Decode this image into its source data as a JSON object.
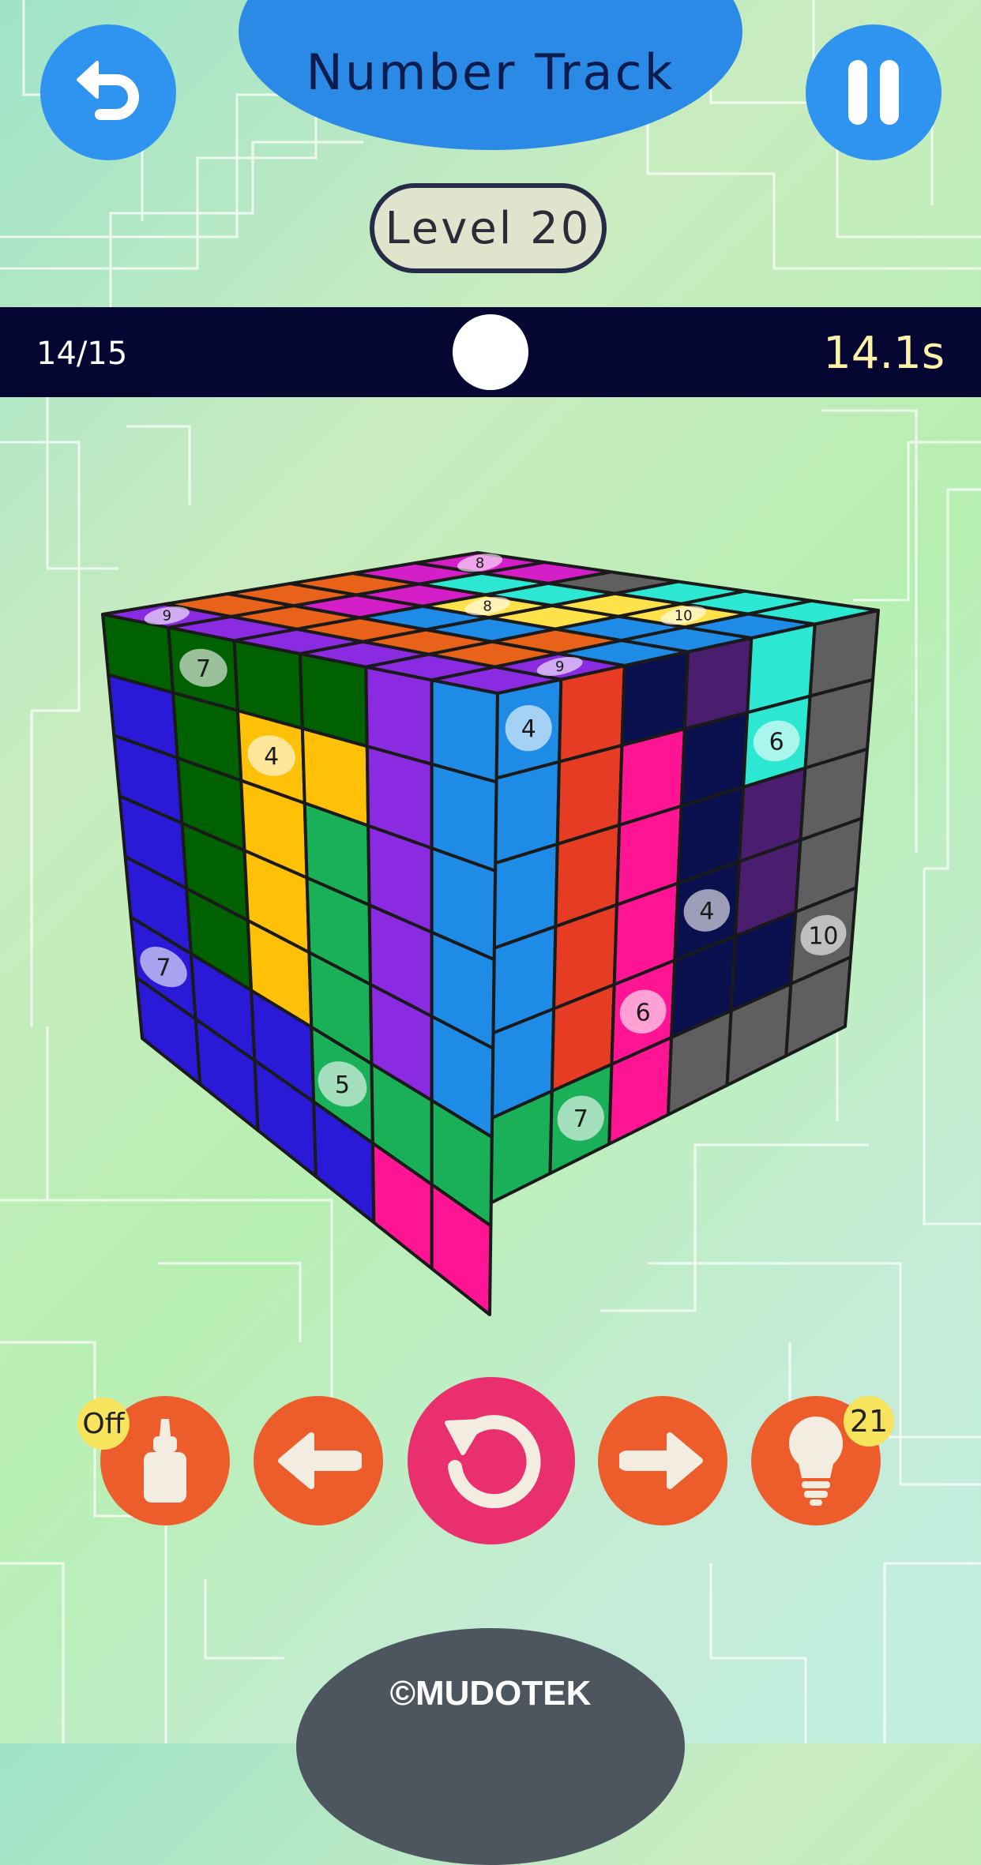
{
  "header": {
    "title": "Number Track",
    "level_label": "Level 20",
    "back_icon": "undo-arrow-icon",
    "pause_icon": "pause-icon"
  },
  "status": {
    "progress_text": "14/15",
    "timer_text": "14.1s"
  },
  "toolbar": {
    "glue_badge": "Off",
    "glue_icon": "glue-bottle-icon",
    "left_icon": "arrow-left-icon",
    "reset_icon": "rotate-reset-icon",
    "right_icon": "arrow-right-icon",
    "hint_icon": "lightbulb-icon",
    "hint_count": "21"
  },
  "footer": {
    "brand": "©MUDOTEK"
  },
  "colors": {
    "title_pill": "#2b8ae6",
    "round_button": "#2f94ef",
    "status_bar": "#060632",
    "tool_button": "#ec5d2b",
    "reset_button": "#ea2f6f",
    "badge": "#f7e35c",
    "footer": "#4d555e"
  },
  "cube": {
    "front_face": [
      [
        "#1e8ce6",
        "#e63c23",
        "#0a0f4e",
        "#4a1d6e",
        "#2ce8d2",
        "#5f5f5f"
      ],
      [
        "#1e8ce6",
        "#e63c23",
        "#ff1493",
        "#0a0f4e",
        "#2ce8d2",
        "#5f5f5f"
      ],
      [
        "#1e8ce6",
        "#e63c23",
        "#ff1493",
        "#0a0f4e",
        "#4a1d6e",
        "#5f5f5f"
      ],
      [
        "#1e8ce6",
        "#e63c23",
        "#ff1493",
        "#0a0f4e",
        "#4a1d6e",
        "#5f5f5f"
      ],
      [
        "#1e8ce6",
        "#e63c23",
        "#ff1493",
        "#0a0f4e",
        "#0a0f4e",
        "#5f5f5f"
      ],
      [
        "#1ab057",
        "#1ab057",
        "#ff1493",
        "#5f5f5f",
        "#5f5f5f",
        "#5f5f5f"
      ]
    ],
    "front_numbers": [
      {
        "row": 0,
        "col": 0,
        "value": "4"
      },
      {
        "row": 1,
        "col": 4,
        "value": "6"
      },
      {
        "row": 3,
        "col": 3,
        "value": "4"
      },
      {
        "row": 4,
        "col": 2,
        "value": "6"
      },
      {
        "row": 4,
        "col": 5,
        "value": "10"
      },
      {
        "row": 5,
        "col": 1,
        "value": "7"
      }
    ],
    "left_face": [
      [
        "#006100",
        "#006100",
        "#006100",
        "#006100",
        "#8a2be2",
        "#1e8ce6"
      ],
      [
        "#2a1ad8",
        "#006100",
        "#ffc107",
        "#ffc107",
        "#8a2be2",
        "#1e8ce6"
      ],
      [
        "#2a1ad8",
        "#006100",
        "#ffc107",
        "#1ab057",
        "#8a2be2",
        "#1e8ce6"
      ],
      [
        "#2a1ad8",
        "#006100",
        "#ffc107",
        "#1ab057",
        "#8a2be2",
        "#1e8ce6"
      ],
      [
        "#2a1ad8",
        "#006100",
        "#ffc107",
        "#1ab057",
        "#8a2be2",
        "#1e8ce6"
      ],
      [
        "#2a1ad8",
        "#2a1ad8",
        "#2a1ad8",
        "#1ab057",
        "#1ab057",
        "#1ab057"
      ],
      [
        "#2a1ad8",
        "#2a1ad8",
        "#2a1ad8",
        "#2a1ad8",
        "#ff1493",
        "#ff1493"
      ]
    ],
    "left_numbers": [
      {
        "row": 0,
        "col": 1,
        "value": "7"
      },
      {
        "row": 1,
        "col": 2,
        "value": "4"
      },
      {
        "row": 5,
        "col": 0,
        "value": "7"
      },
      {
        "row": 5,
        "col": 3,
        "value": "5"
      }
    ],
    "top_face": [
      [
        "#8a2be2",
        "#e8621a",
        "#e8621a",
        "#e8621a",
        "#d41ec8",
        "#d41ec8"
      ],
      [
        "#8a2be2",
        "#e8621a",
        "#d41ec8",
        "#d41ec8",
        "#2ce8d2",
        "#d41ec8"
      ],
      [
        "#8a2be2",
        "#e8621a",
        "#1e8ce6",
        "#ffe24a",
        "#2ce8d2",
        "#5f5f5f"
      ],
      [
        "#8a2be2",
        "#e8621a",
        "#1e8ce6",
        "#ffe24a",
        "#ffe24a",
        "#2ce8d2"
      ],
      [
        "#8a2be2",
        "#e8621a",
        "#e8621a",
        "#1e8ce6",
        "#ffe24a",
        "#2ce8d2"
      ],
      [
        "#8a2be2",
        "#8a2be2",
        "#1e8ce6",
        "#1e8ce6",
        "#1e8ce6",
        "#2ce8d2"
      ]
    ],
    "top_numbers": [
      {
        "row": 0,
        "col": 0,
        "value": "9"
      },
      {
        "row": 5,
        "col": 1,
        "value": "9"
      },
      {
        "row": 4,
        "col": 4,
        "value": "10"
      },
      {
        "row": 2,
        "col": 3,
        "value": "8"
      },
      {
        "row": 0,
        "col": 5,
        "value": "8"
      }
    ]
  }
}
